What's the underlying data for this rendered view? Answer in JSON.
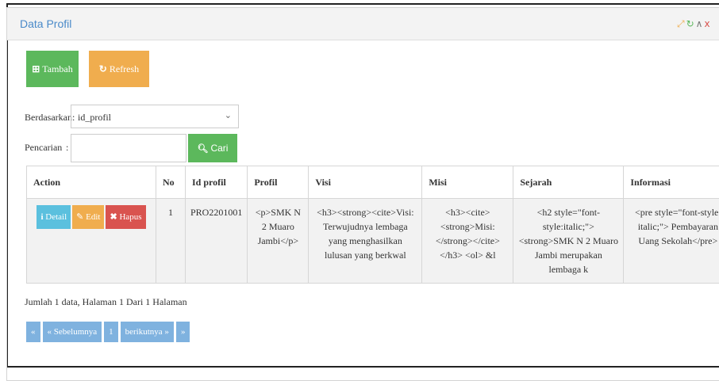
{
  "panel": {
    "title": "Data Profil"
  },
  "tools": {
    "expand": "⤢",
    "refresh": "↻",
    "collapse": "∧",
    "close": "x"
  },
  "toolbar": {
    "tambah_label": "Tambah",
    "refresh_label": "Refresh"
  },
  "search": {
    "by_label": "Berdasarkan:",
    "by_value": "id_profil",
    "query_label": "Pencarian",
    "query_sep": ":",
    "query_value": "",
    "button_label": "Cari"
  },
  "table": {
    "headers": [
      "Action",
      "No",
      "Id profil",
      "Profil",
      "Visi",
      "Misi",
      "Sejarah",
      "Informasi"
    ],
    "actions": {
      "detail": "Detail",
      "edit": "Edit",
      "hapus": "Hapus"
    },
    "rows": [
      {
        "no": "1",
        "id_profil": "PRO2201001",
        "profil": "<p>SMK N 2 Muaro Jambi</p>",
        "visi": "<h3><strong><cite>Visi: Terwujudnya lembaga yang menghasilkan lulusan yang berkwal",
        "misi": "<h3><cite> <strong>Misi: </strong></cite></h3> <ol> &l",
        "sejarah": "<h2 style=\"font-style:italic;\"><strong>SMK N 2 Muaro Jambi merupakan lembaga k",
        "informasi": "<pre style=\"font-style: italic;\"> Pembayaran Uang Sekolah</pre>"
      }
    ]
  },
  "summary": "Jumlah 1 data, Halaman 1 Dari 1 Halaman",
  "pagination": {
    "first": "«",
    "prev": "« Sebelumnya",
    "current": "1",
    "next": "berikutnya »",
    "last": "»"
  },
  "colors": {
    "green": "#5cb85c",
    "orange": "#f0ad4e",
    "info": "#5bc0de",
    "danger": "#d9534f",
    "title": "#4a8ac9"
  }
}
